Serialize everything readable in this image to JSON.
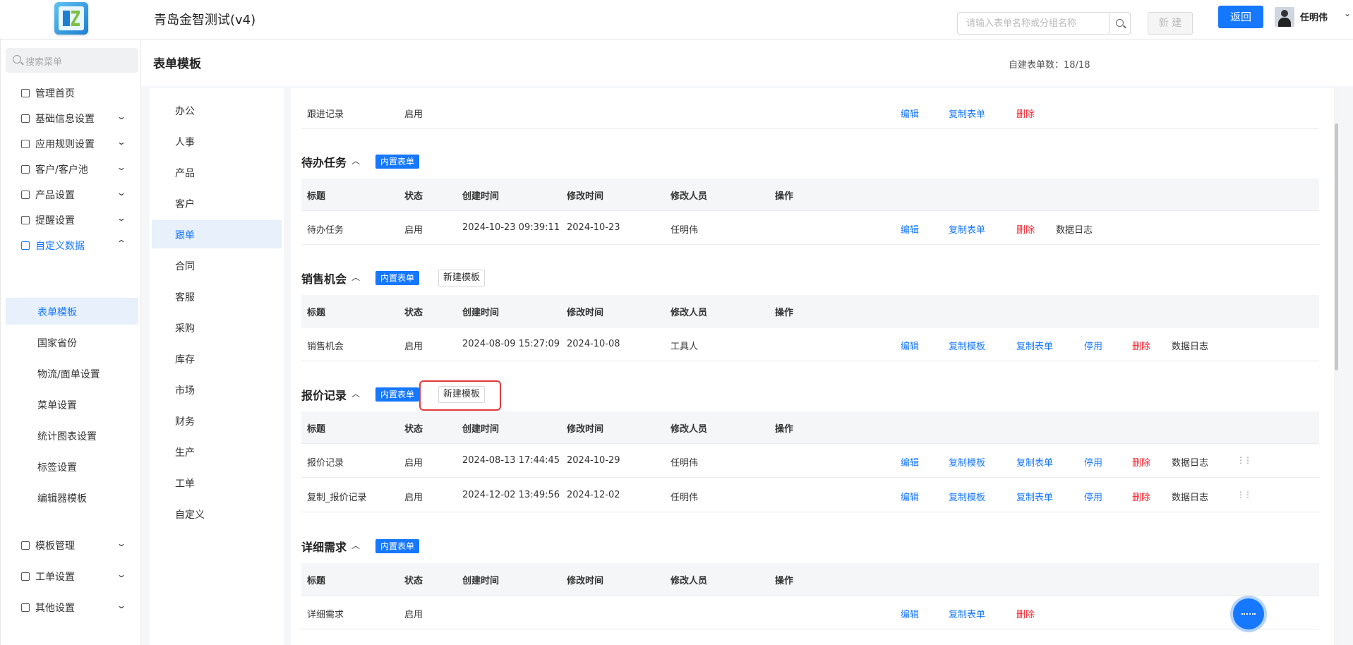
{
  "app": {
    "title": "青岛金智测试(v4)",
    "back_label": "返回",
    "username": "任明伟",
    "user_caret": "⌄"
  },
  "sidebar": {
    "search_placeholder": "搜索菜单",
    "items": [
      {
        "label": "管理首页",
        "icon": "home-icon",
        "caret": ""
      },
      {
        "label": "基础信息设置",
        "icon": "cube-icon",
        "caret": "⌄"
      },
      {
        "label": "应用规则设置",
        "icon": "document-icon",
        "caret": "⌄"
      },
      {
        "label": "客户/客户池",
        "icon": "users-icon",
        "caret": "⌄"
      },
      {
        "label": "产品设置",
        "icon": "box-icon",
        "caret": "⌄"
      },
      {
        "label": "提醒设置",
        "icon": "bell-icon",
        "caret": "⌄"
      },
      {
        "label": "自定义数据",
        "icon": "tools-icon",
        "caret": "⌃"
      }
    ],
    "sub_items": [
      {
        "label": "表单模板"
      },
      {
        "label": "国家省份"
      },
      {
        "label": "物流/面单设置"
      },
      {
        "label": "菜单设置"
      },
      {
        "label": "统计图表设置"
      },
      {
        "label": "标签设置"
      },
      {
        "label": "编辑器模板"
      }
    ],
    "bottom_items": [
      {
        "label": "模板管理",
        "icon": "layout-icon",
        "caret": "⌄"
      },
      {
        "label": "工单设置",
        "icon": "clipboard-icon",
        "caret": "⌄"
      },
      {
        "label": "其他设置",
        "icon": "grid-icon",
        "caret": "⌄"
      }
    ]
  },
  "page": {
    "title": "表单模板",
    "count_label": "自建表单数：18/18",
    "search_placeholder": "请输入表单名称或分组名称",
    "new_label": "新 建"
  },
  "categories": [
    "办公",
    "人事",
    "产品",
    "客户",
    "跟单",
    "合同",
    "客服",
    "采购",
    "库存",
    "市场",
    "财务",
    "生产",
    "工单",
    "自定义"
  ],
  "selected_category": "跟单",
  "columns": [
    "标题",
    "状态",
    "创建时间",
    "修改时间",
    "修改人员",
    "操作"
  ],
  "tag_builtin": "内置表单",
  "new_template_label": "新建模板",
  "actions": {
    "edit": "编辑",
    "copy_template": "复制模板",
    "copy_form": "复制表单",
    "disable": "停用",
    "delete": "删除",
    "log": "数据日志"
  },
  "top_row": {
    "title": "跟进记录",
    "status": "启用"
  },
  "sections": [
    {
      "name": "待办任务",
      "rows": [
        {
          "title": "待办任务",
          "status": "启用",
          "created": "2024-10-23 09:39:11",
          "modified": "2024-10-23",
          "modifier": "任明伟"
        }
      ]
    },
    {
      "name": "销售机会",
      "rows": [
        {
          "title": "销售机会",
          "status": "启用",
          "created": "2024-08-09 15:27:09",
          "modified": "2024-10-08",
          "modifier": "工具人"
        }
      ]
    },
    {
      "name": "报价记录",
      "rows": [
        {
          "title": "报价记录",
          "status": "启用",
          "created": "2024-08-13 17:44:45",
          "modified": "2024-10-29",
          "modifier": "任明伟"
        },
        {
          "title": "复制_报价记录",
          "status": "启用",
          "created": "2024-12-02 13:49:56",
          "modified": "2024-12-02",
          "modifier": "任明伟"
        }
      ]
    },
    {
      "name": "详细需求",
      "rows": [
        {
          "title": "详细需求",
          "status": "启用",
          "created": "",
          "modified": "",
          "modifier": ""
        }
      ]
    }
  ],
  "colors": {
    "accent": "#1677ff",
    "danger": "#f5222d",
    "highlight": "#e03a3a"
  }
}
